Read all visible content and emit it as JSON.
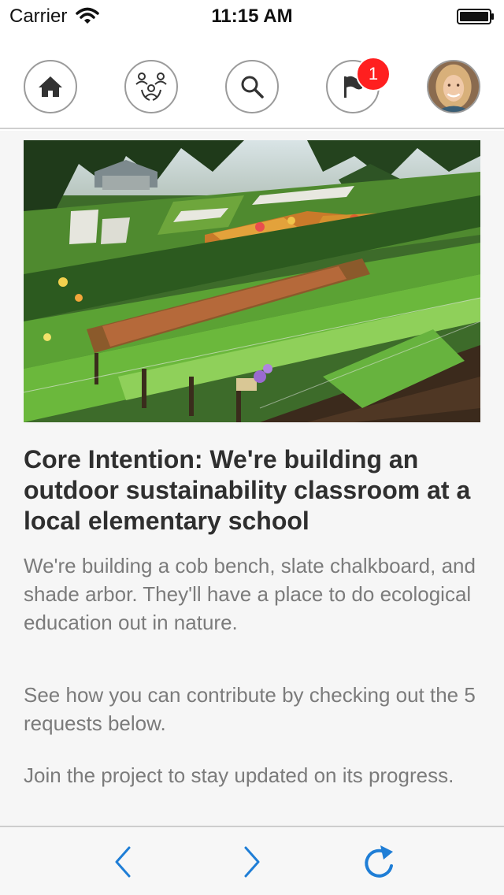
{
  "status_bar": {
    "carrier": "Carrier",
    "time": "11:15 AM"
  },
  "nav": {
    "items": [
      {
        "icon": "home-icon"
      },
      {
        "icon": "community-icon"
      },
      {
        "icon": "search-icon"
      },
      {
        "icon": "flag-icon",
        "badge": "1"
      },
      {
        "icon": "avatar"
      }
    ]
  },
  "project": {
    "title": "Core Intention: We're building an outdoor sustainability classroom at a local elementary school",
    "paragraphs": [
      "We're building a cob bench, slate chalkboard, and shade arbor. They'll have a place to do ecological education out in nature.",
      "See how you can contribute by checking out the 5 requests below.",
      "Join the project to stay updated on its progress."
    ]
  },
  "toolbar": {
    "icons": [
      "back-icon",
      "forward-icon",
      "refresh-icon"
    ]
  },
  "colors": {
    "accent": "#1f7ed6",
    "badge": "#ff1f1f"
  }
}
